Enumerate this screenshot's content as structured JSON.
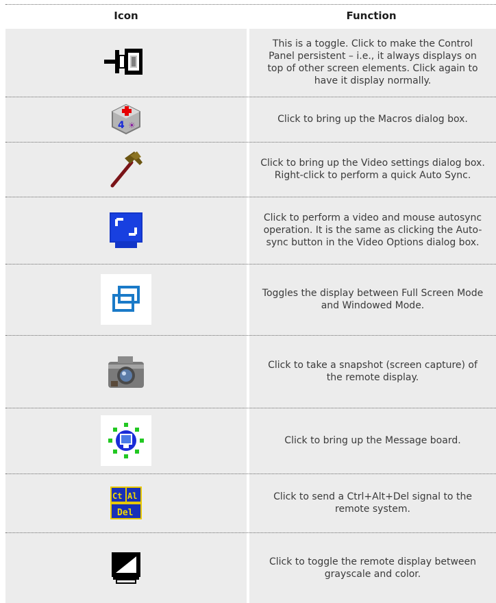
{
  "table": {
    "header": {
      "icon": "Icon",
      "function": "Function"
    },
    "rows": [
      {
        "icon": "pin-icon",
        "function": "This is a toggle. Click to make the Control Panel persistent – i.e., it always displays on top of other screen elements. Click again to have  it display normally."
      },
      {
        "icon": "macros-icon",
        "function": "Click to bring up the Macros dialog box."
      },
      {
        "icon": "hammer-icon",
        "function": "Click to bring up the Video settings dialog box. Right-click to perform  a quick Auto Sync."
      },
      {
        "icon": "autosync-icon",
        "function": "Click to perform a video and mouse autosync operation. It is the  same as clicking the Auto-sync button in the Video Options dialog box."
      },
      {
        "icon": "fullscreen-toggle-icon",
        "function": "Toggles the display between Full Screen Mode and Windowed Mode."
      },
      {
        "icon": "camera-icon",
        "function": "Click to take a snapshot (screen capture) of the remote display."
      },
      {
        "icon": "message-board-icon",
        "function": "Click to bring up the Message board."
      },
      {
        "icon": "ctrl-alt-del-icon",
        "function": "Click to send a Ctrl+Alt+Del signal to the remote system."
      },
      {
        "icon": "grayscale-icon",
        "function": "Click to toggle the remote display between grayscale and color."
      }
    ],
    "colors": {
      "shade": "#ececec",
      "divider": "#6a6a6a",
      "text": "#3a3a3a"
    },
    "icon_labels": {
      "ctrl": "Ct",
      "alt": "Al",
      "del": "Del"
    }
  }
}
